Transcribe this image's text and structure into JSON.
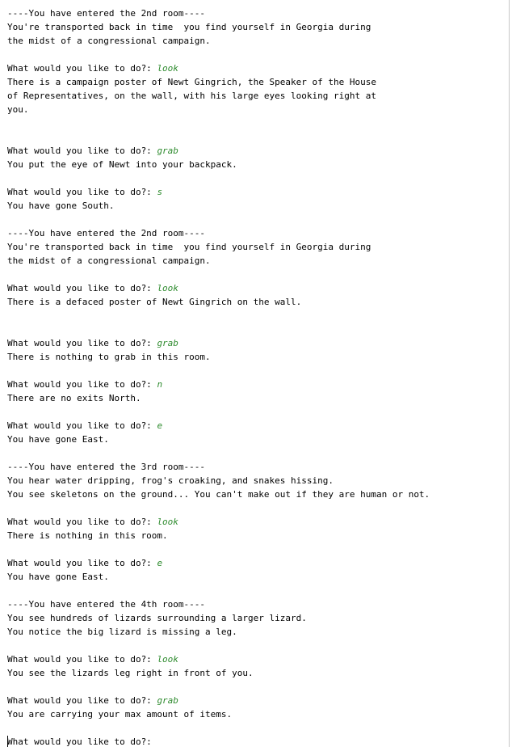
{
  "prompt": "What would you like to do?: ",
  "final_prompt": "What would you like to do?:",
  "lines": [
    {
      "t": "out",
      "text": "----You have entered the 2nd room----"
    },
    {
      "t": "out",
      "text": "You're transported back in time  you find yourself in Georgia during"
    },
    {
      "t": "out",
      "text": "the midst of a congressional campaign."
    },
    {
      "t": "blank"
    },
    {
      "t": "cmd",
      "text": "look"
    },
    {
      "t": "out",
      "text": "There is a campaign poster of Newt Gingrich, the Speaker of the House"
    },
    {
      "t": "out",
      "text": "of Representatives, on the wall, with his large eyes looking right at"
    },
    {
      "t": "out",
      "text": "you."
    },
    {
      "t": "blank"
    },
    {
      "t": "blank"
    },
    {
      "t": "cmd",
      "text": "grab"
    },
    {
      "t": "out",
      "text": "You put the eye of Newt into your backpack."
    },
    {
      "t": "blank"
    },
    {
      "t": "cmd",
      "text": "s"
    },
    {
      "t": "out",
      "text": "You have gone South."
    },
    {
      "t": "blank"
    },
    {
      "t": "out",
      "text": "----You have entered the 2nd room----"
    },
    {
      "t": "out",
      "text": "You're transported back in time  you find yourself in Georgia during"
    },
    {
      "t": "out",
      "text": "the midst of a congressional campaign."
    },
    {
      "t": "blank"
    },
    {
      "t": "cmd",
      "text": "look"
    },
    {
      "t": "out",
      "text": "There is a defaced poster of Newt Gingrich on the wall."
    },
    {
      "t": "blank"
    },
    {
      "t": "blank"
    },
    {
      "t": "cmd",
      "text": "grab"
    },
    {
      "t": "out",
      "text": "There is nothing to grab in this room."
    },
    {
      "t": "blank"
    },
    {
      "t": "cmd",
      "text": "n"
    },
    {
      "t": "out",
      "text": "There are no exits North."
    },
    {
      "t": "blank"
    },
    {
      "t": "cmd",
      "text": "e"
    },
    {
      "t": "out",
      "text": "You have gone East."
    },
    {
      "t": "blank"
    },
    {
      "t": "out",
      "text": "----You have entered the 3rd room----"
    },
    {
      "t": "out",
      "text": "You hear water dripping, frog's croaking, and snakes hissing."
    },
    {
      "t": "out",
      "text": "You see skeletons on the ground... You can't make out if they are human or not."
    },
    {
      "t": "blank"
    },
    {
      "t": "cmd",
      "text": "look"
    },
    {
      "t": "out",
      "text": "There is nothing in this room."
    },
    {
      "t": "blank"
    },
    {
      "t": "cmd",
      "text": "e"
    },
    {
      "t": "out",
      "text": "You have gone East."
    },
    {
      "t": "blank"
    },
    {
      "t": "out",
      "text": "----You have entered the 4th room----"
    },
    {
      "t": "out",
      "text": "You see hundreds of lizards surrounding a larger lizard."
    },
    {
      "t": "out",
      "text": "You notice the big lizard is missing a leg."
    },
    {
      "t": "blank"
    },
    {
      "t": "cmd",
      "text": "look"
    },
    {
      "t": "out",
      "text": "You see the lizards leg right in front of you."
    },
    {
      "t": "blank"
    },
    {
      "t": "cmd",
      "text": "grab"
    },
    {
      "t": "out",
      "text": "You are carrying your max amount of items."
    },
    {
      "t": "blank"
    },
    {
      "t": "final"
    }
  ]
}
